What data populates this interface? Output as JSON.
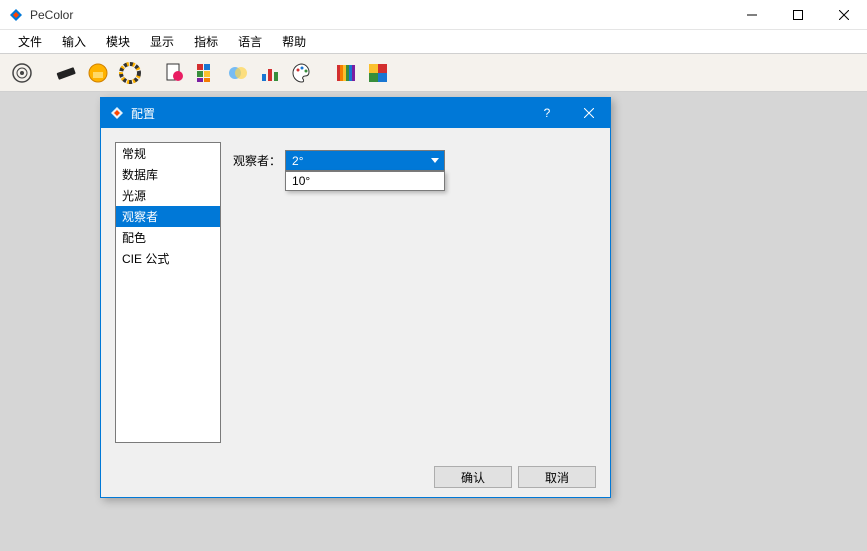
{
  "window": {
    "title": "PeColor"
  },
  "menu": [
    "文件",
    "输入",
    "模块",
    "显示",
    "指标",
    "语言",
    "帮助"
  ],
  "dialog": {
    "title": "配置",
    "categories": [
      "常规",
      "数据库",
      "光源",
      "观察者",
      "配色",
      "CIE 公式"
    ],
    "selected_category_index": 3,
    "field_label": "观察者：",
    "selected_value": "2°",
    "options": [
      "2°",
      "10°"
    ],
    "ok": "确认",
    "cancel": "取消"
  }
}
